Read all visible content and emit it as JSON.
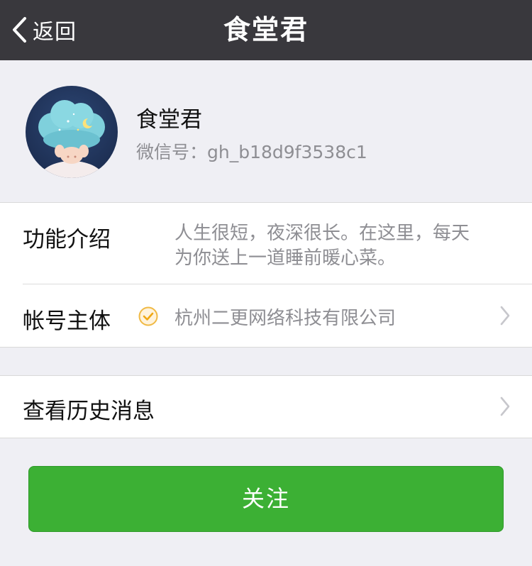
{
  "nav": {
    "back_label": "返回",
    "title": "食堂君"
  },
  "profile": {
    "name": "食堂君",
    "wechat_id_label": "微信号：",
    "wechat_id": "gh_b18d9f3538c1",
    "avatar_icon": "cloud-head-avatar"
  },
  "info": {
    "intro_label": "功能介绍",
    "intro_lines": [
      "人生很短，夜深很长。在这里，每天",
      "为你送上一道睡前暖心菜。"
    ],
    "account_label": "帐号主体",
    "account_verified_icon": "verified-check-icon",
    "account_value": "杭州二更网络科技有限公司"
  },
  "history": {
    "label": "查看历史消息"
  },
  "follow_button": {
    "label": "关注"
  },
  "colors": {
    "navbar": "#39383d",
    "background": "#efeff4",
    "button_green": "#3cb034",
    "verified": "#f0b944"
  }
}
